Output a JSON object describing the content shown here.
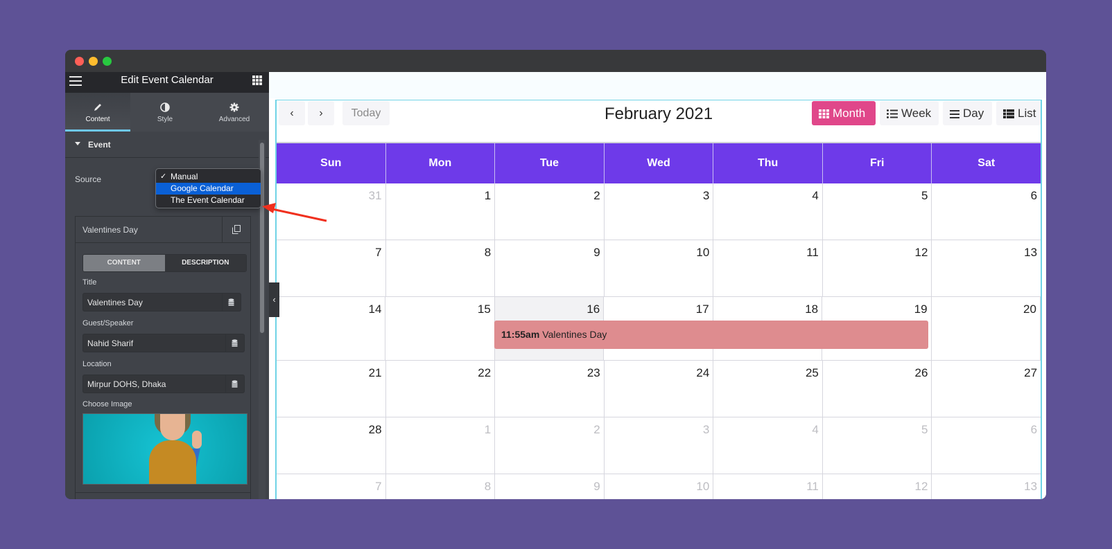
{
  "window": {
    "controls": [
      "close",
      "minimize",
      "maximize"
    ]
  },
  "sidebar": {
    "title": "Edit Event Calendar",
    "tabs": [
      {
        "label": "Content",
        "icon": "pencil-icon",
        "active": true
      },
      {
        "label": "Style",
        "icon": "half-circle-icon",
        "active": false
      },
      {
        "label": "Advanced",
        "icon": "gear-icon",
        "active": false
      }
    ],
    "section": {
      "label": "Event",
      "expanded": true
    },
    "source": {
      "label": "Source",
      "selected": "Manual",
      "highlighted": "Google Calendar",
      "options": [
        "Manual",
        "Google Calendar",
        "The Event Calendar"
      ]
    },
    "repeater_item": {
      "title": "Valentines Day",
      "segments": [
        "CONTENT",
        "DESCRIPTION"
      ],
      "active_segment": "CONTENT",
      "fields": {
        "title": {
          "label": "Title",
          "value": "Valentines Day"
        },
        "guest": {
          "label": "Guest/Speaker",
          "value": "Nahid Sharif"
        },
        "location": {
          "label": "Location",
          "value": "Mirpur DOHS, Dhaka"
        },
        "image": {
          "label": "Choose Image"
        }
      }
    }
  },
  "calendar": {
    "title": "February 2021",
    "nav": {
      "prev": "‹",
      "next": "›",
      "today": "Today"
    },
    "views": [
      {
        "label": "Month",
        "icon": "grid-icon",
        "active": true
      },
      {
        "label": "Week",
        "icon": "list-ul-icon",
        "active": false
      },
      {
        "label": "Day",
        "icon": "bars-icon",
        "active": false
      },
      {
        "label": "List",
        "icon": "table-list-icon",
        "active": false
      }
    ],
    "weekdays": [
      "Sun",
      "Mon",
      "Tue",
      "Wed",
      "Thu",
      "Fri",
      "Sat"
    ],
    "weeks": [
      [
        {
          "d": "31",
          "other": true
        },
        {
          "d": "1"
        },
        {
          "d": "2"
        },
        {
          "d": "3"
        },
        {
          "d": "4"
        },
        {
          "d": "5"
        },
        {
          "d": "6"
        }
      ],
      [
        {
          "d": "7"
        },
        {
          "d": "8"
        },
        {
          "d": "9"
        },
        {
          "d": "10"
        },
        {
          "d": "11"
        },
        {
          "d": "12"
        },
        {
          "d": "13"
        }
      ],
      [
        {
          "d": "14"
        },
        {
          "d": "15"
        },
        {
          "d": "16",
          "today": true
        },
        {
          "d": "17"
        },
        {
          "d": "18"
        },
        {
          "d": "19"
        },
        {
          "d": "20"
        }
      ],
      [
        {
          "d": "21"
        },
        {
          "d": "22"
        },
        {
          "d": "23"
        },
        {
          "d": "24"
        },
        {
          "d": "25"
        },
        {
          "d": "26"
        },
        {
          "d": "27"
        }
      ],
      [
        {
          "d": "28"
        },
        {
          "d": "1",
          "other": true
        },
        {
          "d": "2",
          "other": true
        },
        {
          "d": "3",
          "other": true
        },
        {
          "d": "4",
          "other": true
        },
        {
          "d": "5",
          "other": true
        },
        {
          "d": "6",
          "other": true
        }
      ],
      [
        {
          "d": "7",
          "other": true
        },
        {
          "d": "8",
          "other": true
        },
        {
          "d": "9",
          "other": true
        },
        {
          "d": "10",
          "other": true
        },
        {
          "d": "11",
          "other": true
        },
        {
          "d": "12",
          "other": true
        },
        {
          "d": "13",
          "other": true
        }
      ]
    ],
    "event": {
      "time": "11:55am",
      "title": "Valentines Day",
      "color": "#de8c8f"
    }
  },
  "colors": {
    "header": "#6e3ae9",
    "active_view": "#e0478a",
    "background": "#5e5296",
    "annotation_arrow": "#f0301e"
  }
}
